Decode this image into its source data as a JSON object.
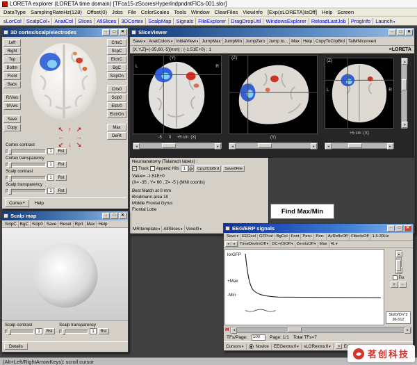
{
  "app": {
    "title": "LORETA explorer (LORETA time domain)  [TFca15-zScoresHyperIndpndntFICs-001.slor]",
    "menu": [
      "DataType",
      "SamplingRateHz(128)",
      "Offset(0)",
      "Jobs",
      "File",
      "ColorScales",
      "Tools",
      "Window",
      "ClearFiles",
      "ViewInfo",
      "[Exp(sLORETA)IsOff]",
      "Help",
      "Screen"
    ],
    "toolbar": [
      "sLorCol",
      "ScalpCol",
      "AnatCol",
      "Slices",
      "AllSlices",
      "3DCortex",
      "ScalpMap",
      "Signals",
      "FileExplorer",
      "DragDropUtil",
      "WindowsExplorer",
      "ReloadLastJob",
      "ProgInfo",
      "Launch"
    ],
    "status": "(Alt+Left/RightArrowKeys): scroll cursor"
  },
  "colors": {
    "titlebar_blue": "#123a78",
    "active_titlebar_blue": "#0b2fa2",
    "toolbar_link_blue": "#0000cc",
    "activation_blue": "#2f5fd8",
    "activation_red": "#d04028",
    "watermark_red": "#d2342b"
  },
  "cortex3d": {
    "title": "3D cortex/scalp/electrodes",
    "view_buttons": [
      "Left",
      "Right",
      "Top",
      "Bottm",
      "Front",
      "Back"
    ],
    "multiview_buttons": [
      "R/Vws",
      "9/Vws"
    ],
    "export_buttons": [
      "Save",
      "Copy"
    ],
    "color_buttons": [
      "CrtxC",
      "ScpC",
      "ElctrC",
      "BgC",
      "SclpOn"
    ],
    "toggle_buttons": [
      "Crtx0",
      "Sclp0",
      "Elctr0",
      "ElctrOn"
    ],
    "misc_buttons": [
      "Max",
      "DeRt"
    ],
    "sliders": [
      {
        "label": "Cortex contrast",
        "value": "1",
        "reset": "Rst"
      },
      {
        "label": "Cortex transparency",
        "value": "1",
        "reset": "Rst"
      },
      {
        "label": "Scalp contrast",
        "value": "1",
        "reset": "Rst"
      },
      {
        "label": "Scalp transparency",
        "value": "1",
        "reset": "Rst"
      }
    ],
    "cortex_dropdown": "Cortex",
    "help_label": "Help"
  },
  "sliceviewer": {
    "title": "SliceViewer",
    "toolbar": [
      "Save",
      "AnatColors",
      "InitialView",
      "JumpMax",
      "JumpMin",
      "JumpZero",
      "Jump to...",
      "Max",
      "Help",
      "CopyToClipBrd",
      "TalMNIconvert"
    ],
    "coord_readout": "[X,Y,Z]=(-35,60,-5)[mm] ;  (-1.51E+0) ;  1",
    "brand": "≡LORETA",
    "slice1": {
      "left": "L",
      "right": "R",
      "axis": "(Y)",
      "scale": "-5      0     +5 cm  (X)"
    },
    "slice2": {
      "axis": "(Z)",
      "scale": "(Y)"
    },
    "slice3": {
      "axis": "(Z)",
      "left": "L",
      "right": "R",
      "scale": "+5 cm  (X)"
    },
    "neuro": {
      "header": "Neuroanatomy (Talairach labels) :",
      "track_label": "Track",
      "append_label": "Append",
      "hits_label": "Hits",
      "hits_value": "1",
      "copy_button": "Cpy2ClpBrd",
      "save_button": "Save2File",
      "lines": [
        "Value= -1.51E+0",
        "(X= -35 , Y= 60 , Z= -5 )   (MNI coords)",
        "Best Match at 0 mm",
        "Brodmann area 10",
        "Middle Frontal Gyrus",
        "Frontal Lobe"
      ]
    },
    "find_button": "Find Max/Min",
    "bottom_toolbar": [
      "MRItemplate",
      "AllSlices",
      "Voxel0"
    ]
  },
  "scalpmap": {
    "title": "Scalp map",
    "toolbar": [
      "SclpC",
      "BgC",
      "Sclp0",
      "Save",
      "Reset",
      "Rprt",
      "Max",
      "Help"
    ],
    "sliders": [
      {
        "label": "Scalp contrast",
        "value": "1",
        "reset": "Rst"
      },
      {
        "label": "Scalp transparency",
        "value": "1",
        "reset": "Rst"
      }
    ],
    "details_button": "Details"
  },
  "eeg": {
    "title": "EEG/ERP signals",
    "toolbar1": [
      "Save",
      "EEGcol",
      "GFPcol",
      "BgCol",
      "Font",
      "Pen+",
      "Pen-",
      "AvRefIsOff",
      "FilterIsOff",
      "1.5-30Hz"
    ],
    "toolbar2": [
      "TimeDevIrsOff",
      "DC+(0)Off",
      "ZeroIsOff",
      "Max",
      "4L"
    ],
    "trace_labels": {
      "gfp": "lorGFP",
      "max": "+Max",
      "min": "-Min"
    },
    "fix_label": "Fix",
    "marker": "M",
    "readout_line1": "StdO/Dn^2",
    "readout_line2": "36.612",
    "tfs_label": "TFs/Page:",
    "tfs_value": "100",
    "page_label": "Page: 1/1",
    "total_label": "Total TFs=7",
    "bottom": [
      "Cursors",
      "Novice",
      "EEGextra:0",
      "sLORextra:0",
      "Edit"
    ]
  },
  "states": {
    "track_checked": true,
    "append_checked": false,
    "fix_checked": false,
    "novice_selected": true
  },
  "watermark": {
    "text": "茗创科技"
  }
}
